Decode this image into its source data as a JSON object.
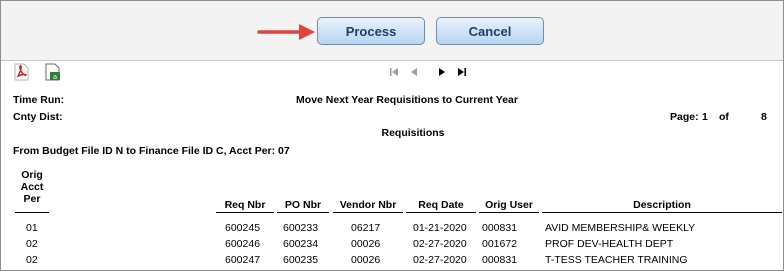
{
  "toolbar": {
    "process_label": "Process",
    "cancel_label": "Cancel",
    "colors": {
      "button_text": "#1f3f66",
      "arrow": "#e0453a"
    }
  },
  "report": {
    "time_run_label": "Time Run:",
    "title": "Move Next Year Requisitions to Current Year",
    "cnty_dist_label": "Cnty Dist:",
    "page_label": "Page:",
    "page_number": "1",
    "of_label": "of",
    "page_total": "8",
    "section_title": "Requisitions",
    "subtitle": "From Budget File ID N to Finance File ID C, Acct Per: 07",
    "columns": {
      "orig": "Orig",
      "acct": "Acct",
      "per": "Per",
      "req_nbr": "Req Nbr",
      "po_nbr": "PO Nbr",
      "vendor_nbr": "Vendor Nbr",
      "req_date": "Req Date",
      "orig_user": "Orig User",
      "description": "Description"
    },
    "rows": [
      {
        "per": "01",
        "req_nbr": "600245",
        "po_nbr": "600233",
        "vendor_nbr": "06217",
        "req_date": "01-21-2020",
        "orig_user": "000831",
        "description": "AVID MEMBERSHIP& WEEKLY"
      },
      {
        "per": "02",
        "req_nbr": "600246",
        "po_nbr": "600234",
        "vendor_nbr": "00026",
        "req_date": "02-27-2020",
        "orig_user": "001672",
        "description": "PROF DEV-HEALTH DEPT"
      },
      {
        "per": "02",
        "req_nbr": "600247",
        "po_nbr": "600235",
        "vendor_nbr": "00026",
        "req_date": "02-27-2020",
        "orig_user": "000831",
        "description": "T-TESS TEACHER TRAINING"
      }
    ]
  }
}
